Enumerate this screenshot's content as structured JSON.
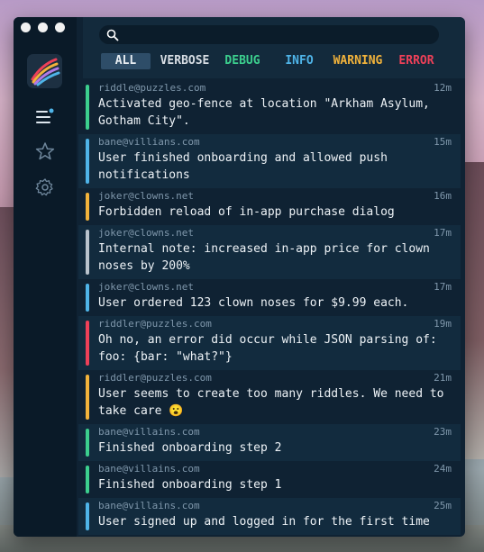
{
  "colors": {
    "debug": "#3ccf8e",
    "info": "#4fb4e8",
    "warning": "#f2b33b",
    "error": "#ee4058",
    "verbose": "#b9c3cc"
  },
  "search": {
    "placeholder": ""
  },
  "filters": {
    "all": "ALL",
    "verbose": "VERBOSE",
    "debug": "DEBUG",
    "info": "INFO",
    "warning": "WARNING",
    "error": "ERROR",
    "selected": "ALL"
  },
  "sidebar": {
    "icons": [
      "list-icon",
      "star-icon",
      "gear-icon"
    ]
  },
  "logs": [
    {
      "user": "riddle@puzzles.com",
      "time": "12m",
      "message": "Activated geo-fence at location \"Arkham Asylum,\nGotham City\".",
      "level": "debug"
    },
    {
      "user": "bane@villians.com",
      "time": "15m",
      "message": "User finished onboarding and allowed push\nnotifications",
      "level": "info"
    },
    {
      "user": "joker@clowns.net",
      "time": "16m",
      "message": "Forbidden reload of in-app purchase dialog",
      "level": "warning"
    },
    {
      "user": "joker@clowns.net",
      "time": "17m",
      "message": "Internal note: increased in-app price for clown\nnoses by 200%",
      "level": "verbose"
    },
    {
      "user": "joker@clowns.net",
      "time": "17m",
      "message": "User ordered 123 clown noses for $9.99 each.",
      "level": "info"
    },
    {
      "user": "riddler@puzzles.com",
      "time": "19m",
      "message": "Oh no, an error did occur while JSON parsing of:\nfoo: {bar: \"what?\"}",
      "level": "error"
    },
    {
      "user": "riddler@puzzles.com",
      "time": "21m",
      "message": "User seems to create too many riddles. We need to\ntake care 😮",
      "level": "warning"
    },
    {
      "user": "bane@villains.com",
      "time": "23m",
      "message": "Finished onboarding step 2",
      "level": "debug"
    },
    {
      "user": "bane@villains.com",
      "time": "24m",
      "message": "Finished onboarding step 1",
      "level": "debug"
    },
    {
      "user": "bane@villains.com",
      "time": "25m",
      "message": "User signed up and logged in for the first time",
      "level": "info"
    }
  ]
}
